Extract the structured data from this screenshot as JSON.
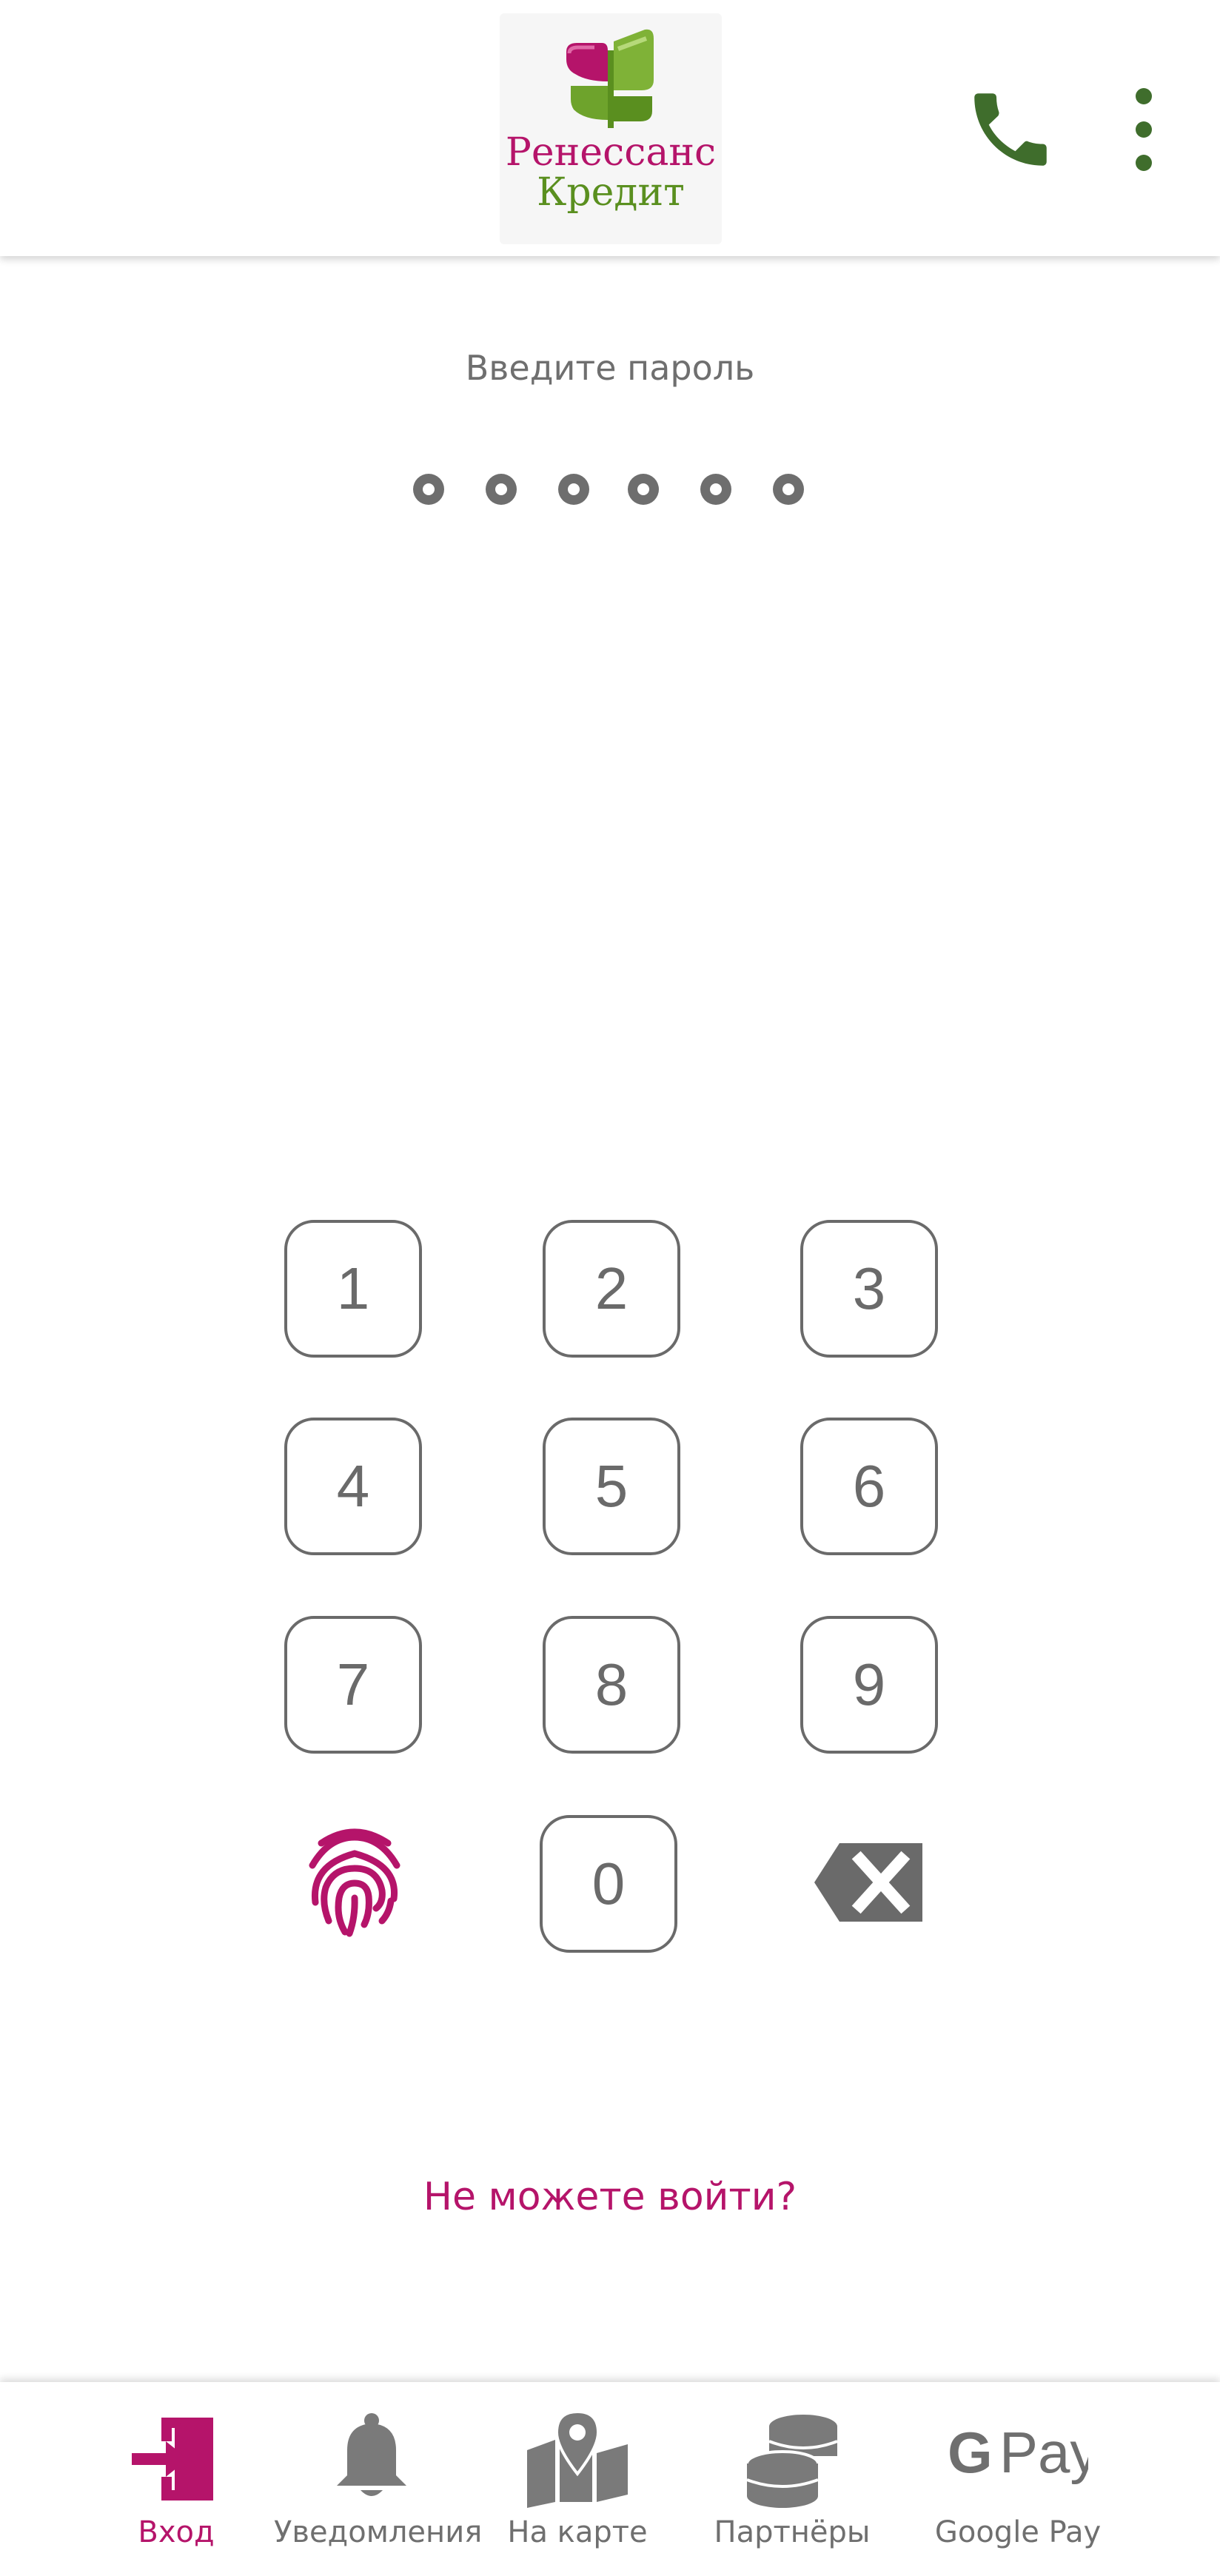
{
  "header": {
    "logo_line1": "Ренессанс",
    "logo_line2": "Кредит",
    "phone_icon": "phone-icon",
    "menu_icon": "more-vert-icon"
  },
  "login": {
    "prompt": "Введите пароль",
    "pin_length": 6,
    "pin_entered": 0
  },
  "keypad": {
    "keys": [
      "1",
      "2",
      "3",
      "4",
      "5",
      "6",
      "7",
      "8",
      "9",
      "0"
    ],
    "fingerprint_icon": "fingerprint-icon",
    "backspace_icon": "backspace-icon"
  },
  "help_link": "Не можете войти?",
  "bottom_nav": {
    "items": [
      {
        "label": "Вход",
        "icon": "login-icon",
        "active": true
      },
      {
        "label": "Уведомления",
        "icon": "bell-icon",
        "active": false
      },
      {
        "label": "На карте",
        "icon": "map-marker-icon",
        "active": false
      },
      {
        "label": "Партнёры",
        "icon": "coins-icon",
        "active": false
      },
      {
        "label": "Google Pay",
        "icon": "google-pay-icon",
        "active": false
      }
    ]
  },
  "colors": {
    "brand_magenta": "#b5146a",
    "brand_green": "#3f6d2c",
    "text_gray": "#6f6f6f"
  }
}
